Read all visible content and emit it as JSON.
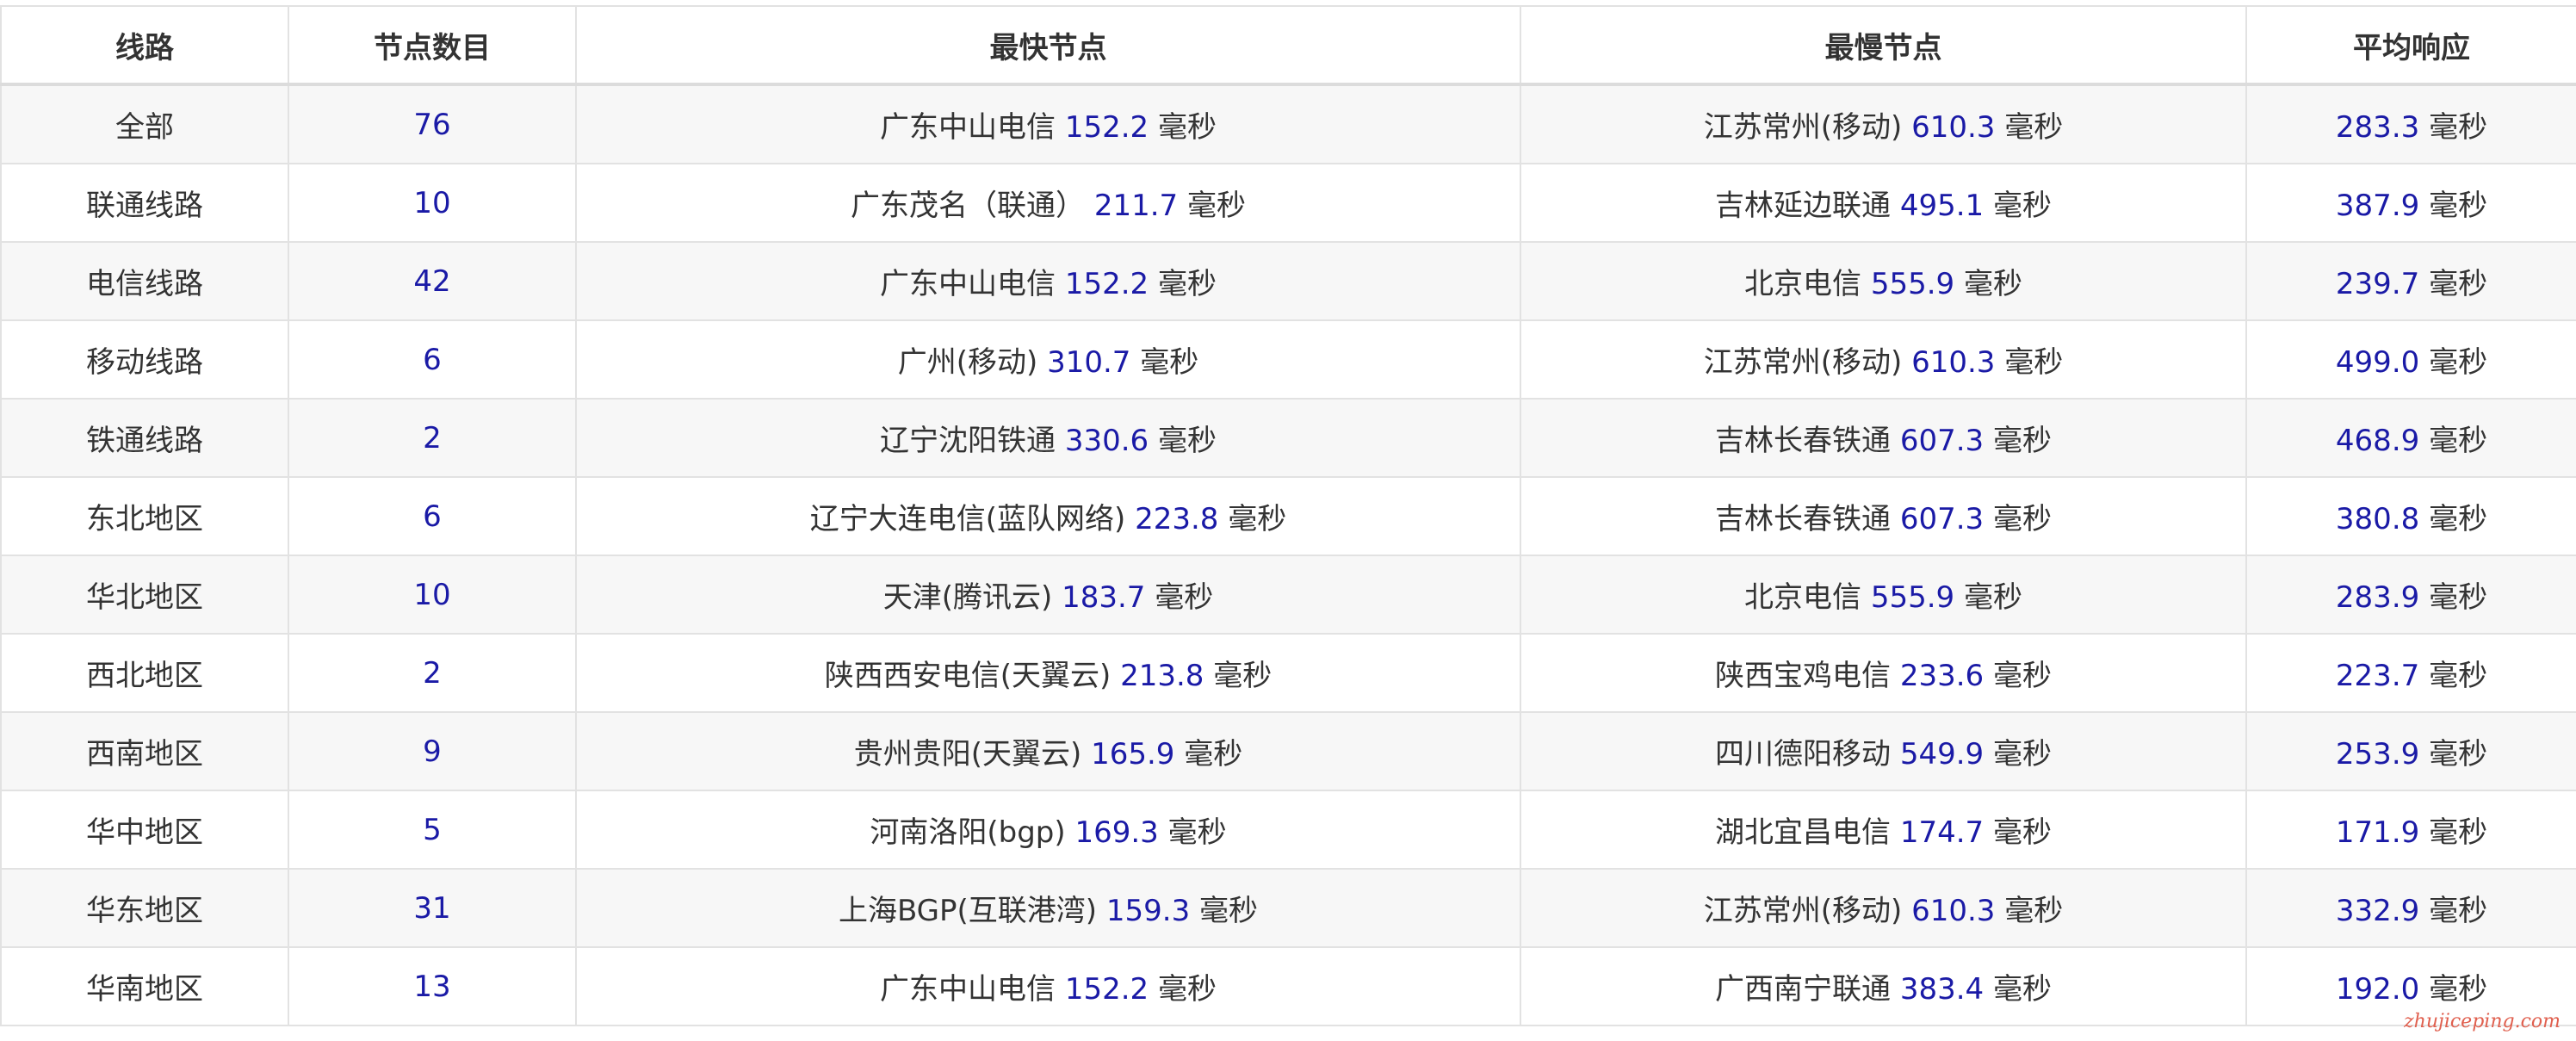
{
  "headers": [
    "线路",
    "节点数目",
    "最快节点",
    "最慢节点",
    "平均响应"
  ],
  "unit": "毫秒",
  "rows": [
    {
      "line": "全部",
      "count": "76",
      "fast_name": "广东中山电信",
      "fast_val": "152.2",
      "slow_name": "江苏常州(移动)",
      "slow_val": "610.3",
      "avg": "283.3"
    },
    {
      "line": "联通线路",
      "count": "10",
      "fast_name": "广东茂名（联通）",
      "fast_val": "211.7",
      "slow_name": "吉林延边联通",
      "slow_val": "495.1",
      "avg": "387.9"
    },
    {
      "line": "电信线路",
      "count": "42",
      "fast_name": "广东中山电信",
      "fast_val": "152.2",
      "slow_name": "北京电信",
      "slow_val": "555.9",
      "avg": "239.7"
    },
    {
      "line": "移动线路",
      "count": "6",
      "fast_name": "广州(移动)",
      "fast_val": "310.7",
      "slow_name": "江苏常州(移动)",
      "slow_val": "610.3",
      "avg": "499.0"
    },
    {
      "line": "铁通线路",
      "count": "2",
      "fast_name": "辽宁沈阳铁通",
      "fast_val": "330.6",
      "slow_name": "吉林长春铁通",
      "slow_val": "607.3",
      "avg": "468.9"
    },
    {
      "line": "东北地区",
      "count": "6",
      "fast_name": "辽宁大连电信(蓝队网络)",
      "fast_val": "223.8",
      "slow_name": "吉林长春铁通",
      "slow_val": "607.3",
      "avg": "380.8"
    },
    {
      "line": "华北地区",
      "count": "10",
      "fast_name": "天津(腾讯云)",
      "fast_val": "183.7",
      "slow_name": "北京电信",
      "slow_val": "555.9",
      "avg": "283.9"
    },
    {
      "line": "西北地区",
      "count": "2",
      "fast_name": "陕西西安电信(天翼云)",
      "fast_val": "213.8",
      "slow_name": "陕西宝鸡电信",
      "slow_val": "233.6",
      "avg": "223.7"
    },
    {
      "line": "西南地区",
      "count": "9",
      "fast_name": "贵州贵阳(天翼云)",
      "fast_val": "165.9",
      "slow_name": "四川德阳移动",
      "slow_val": "549.9",
      "avg": "253.9"
    },
    {
      "line": "华中地区",
      "count": "5",
      "fast_name": "河南洛阳(bgp)",
      "fast_val": "169.3",
      "slow_name": "湖北宜昌电信",
      "slow_val": "174.7",
      "avg": "171.9"
    },
    {
      "line": "华东地区",
      "count": "31",
      "fast_name": "上海BGP(互联港湾)",
      "fast_val": "159.3",
      "slow_name": "江苏常州(移动)",
      "slow_val": "610.3",
      "avg": "332.9"
    },
    {
      "line": "华南地区",
      "count": "13",
      "fast_name": "广东中山电信",
      "fast_val": "152.2",
      "slow_name": "广西南宁联通",
      "slow_val": "383.4",
      "avg": "192.0"
    }
  ],
  "watermark": "zhujiceping.com",
  "colors": {
    "value": "#1a1aa6",
    "text": "#333333",
    "stripe": "#f7f7f7",
    "border": "#e2e2e2"
  }
}
